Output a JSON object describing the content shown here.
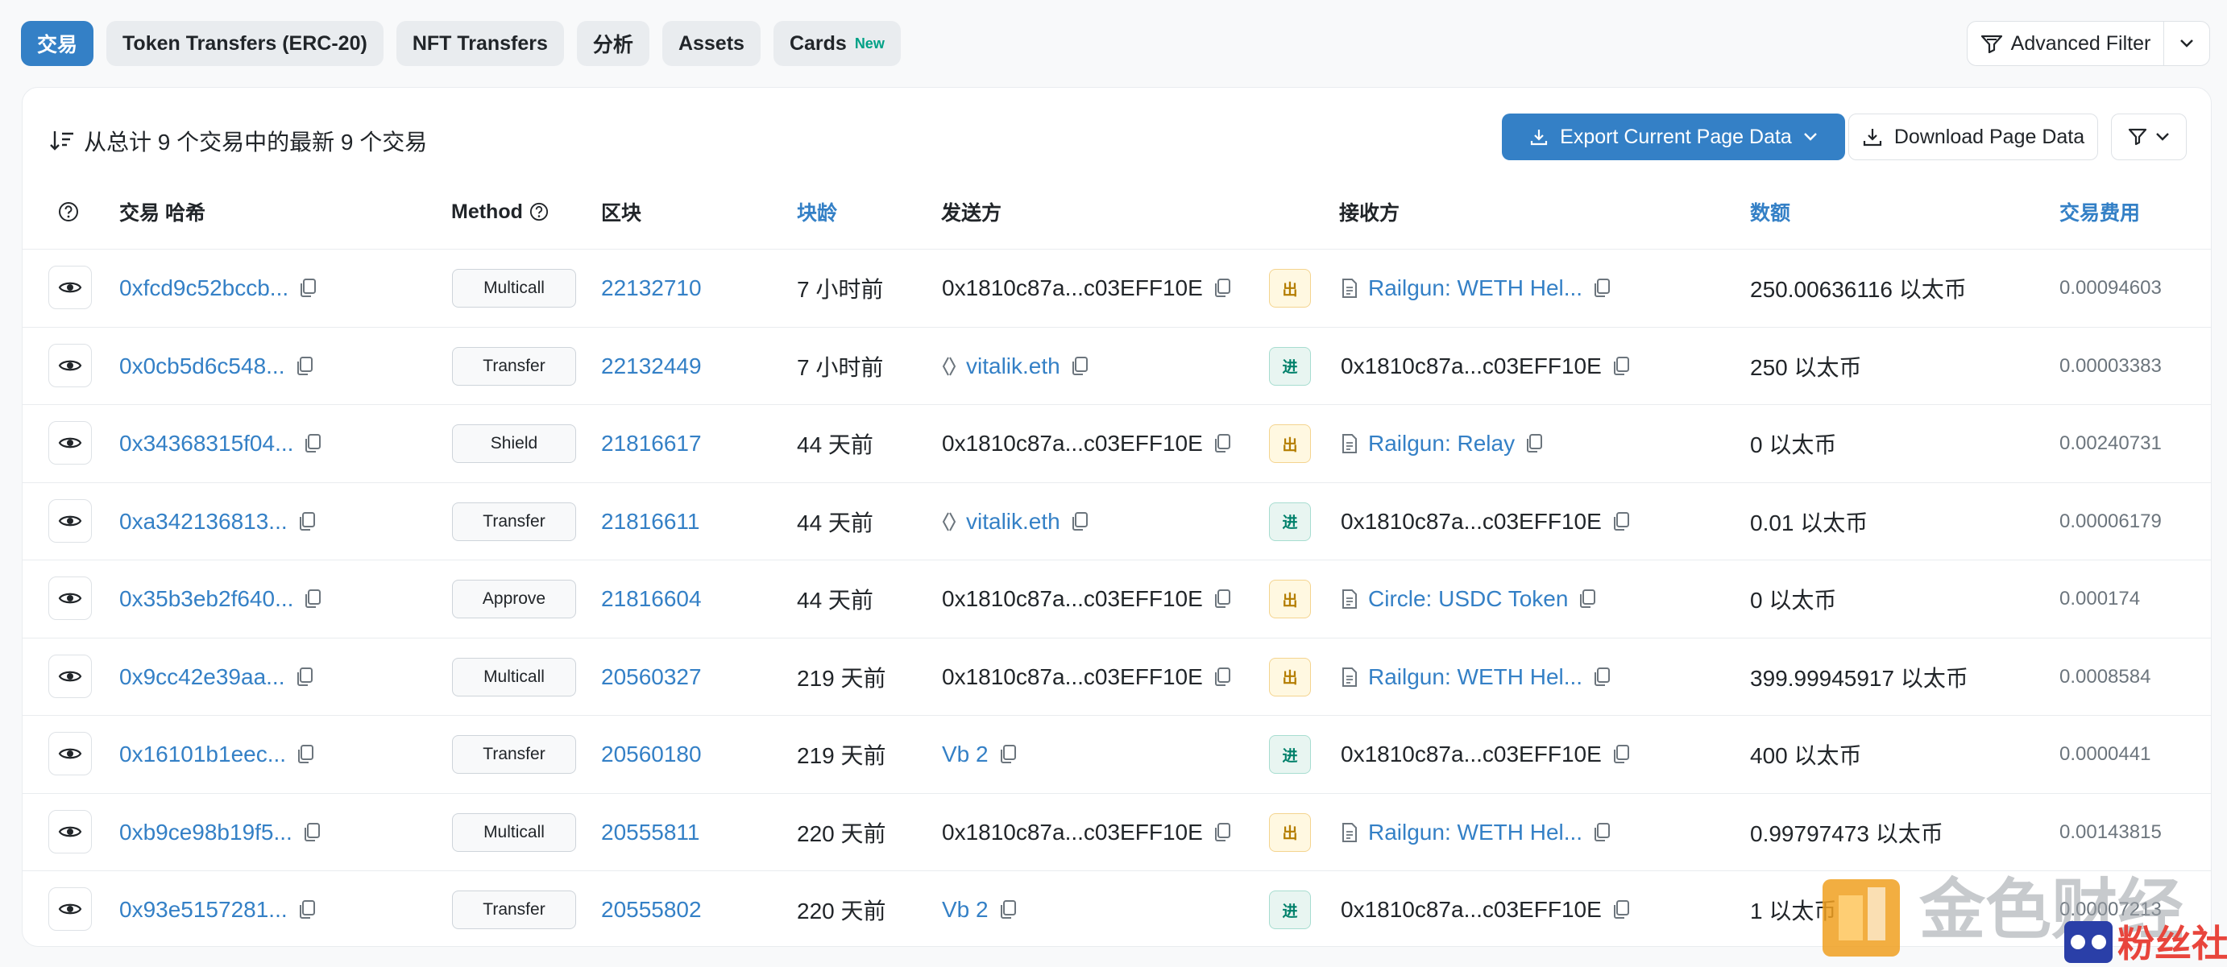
{
  "tabs": [
    {
      "label": "交易",
      "active": true
    },
    {
      "label": "Token Transfers (ERC-20)"
    },
    {
      "label": "NFT Transfers"
    },
    {
      "label": "分析"
    },
    {
      "label": "Assets"
    },
    {
      "label": "Cards",
      "badge": "New"
    }
  ],
  "advanced_filter": {
    "label": "Advanced Filter"
  },
  "summary": "从总计 9 个交易中的最新 9 个交易",
  "toolbar": {
    "export_label": "Export Current Page Data",
    "download_label": "Download Page Data"
  },
  "columns": {
    "hash": "交易 哈希",
    "method": "Method",
    "block": "区块",
    "age": "块龄",
    "from": "发送方",
    "to": "接收方",
    "amount": "数额",
    "fee": "交易费用"
  },
  "rows": [
    {
      "hash": "0xfcd9c52bccb...",
      "method": "Multicall",
      "block": "22132710",
      "age": "7 小时前",
      "from": "0x1810c87a...c03EFF10E",
      "from_type": "address",
      "dir": "出",
      "to": "Railgun: WETH Hel...",
      "to_type": "contract",
      "amount": "250.00636116 以太币",
      "fee": "0.00094603"
    },
    {
      "hash": "0x0cb5d6c548...",
      "method": "Transfer",
      "block": "22132449",
      "age": "7 小时前",
      "from": "vitalik.eth",
      "from_type": "ens",
      "dir": "进",
      "to": "0x1810c87a...c03EFF10E",
      "to_type": "address",
      "amount": "250 以太币",
      "fee": "0.00003383"
    },
    {
      "hash": "0x34368315f04...",
      "method": "Shield",
      "block": "21816617",
      "age": "44 天前",
      "from": "0x1810c87a...c03EFF10E",
      "from_type": "address",
      "dir": "出",
      "to": "Railgun: Relay",
      "to_type": "contract",
      "amount": "0 以太币",
      "fee": "0.00240731"
    },
    {
      "hash": "0xa342136813...",
      "method": "Transfer",
      "block": "21816611",
      "age": "44 天前",
      "from": "vitalik.eth",
      "from_type": "ens",
      "dir": "进",
      "to": "0x1810c87a...c03EFF10E",
      "to_type": "address",
      "amount": "0.01 以太币",
      "fee": "0.00006179"
    },
    {
      "hash": "0x35b3eb2f640...",
      "method": "Approve",
      "block": "21816604",
      "age": "44 天前",
      "from": "0x1810c87a...c03EFF10E",
      "from_type": "address",
      "dir": "出",
      "to": "Circle: USDC Token",
      "to_type": "contract",
      "amount": "0 以太币",
      "fee": "0.000174"
    },
    {
      "hash": "0x9cc42e39aa...",
      "method": "Multicall",
      "block": "20560327",
      "age": "219 天前",
      "from": "0x1810c87a...c03EFF10E",
      "from_type": "address",
      "dir": "出",
      "to": "Railgun: WETH Hel...",
      "to_type": "contract",
      "amount": "399.99945917 以太币",
      "fee": "0.0008584"
    },
    {
      "hash": "0x16101b1eec...",
      "method": "Transfer",
      "block": "20560180",
      "age": "219 天前",
      "from": "Vb 2",
      "from_type": "label",
      "dir": "进",
      "to": "0x1810c87a...c03EFF10E",
      "to_type": "address",
      "amount": "400 以太币",
      "fee": "0.0000441"
    },
    {
      "hash": "0xb9ce98b19f5...",
      "method": "Multicall",
      "block": "20555811",
      "age": "220 天前",
      "from": "0x1810c87a...c03EFF10E",
      "from_type": "address",
      "dir": "出",
      "to": "Railgun: WETH Hel...",
      "to_type": "contract",
      "amount": "0.99797473 以太币",
      "fee": "0.00143815"
    },
    {
      "hash": "0x93e5157281...",
      "method": "Transfer",
      "block": "20555802",
      "age": "220 天前",
      "from": "Vb 2",
      "from_type": "label",
      "dir": "进",
      "to": "0x1810c87a...c03EFF10E",
      "to_type": "address",
      "amount": "1 以太币",
      "fee": "0.00007213"
    }
  ],
  "watermark": {
    "text1": "金色财经",
    "text2": "粉丝社区"
  },
  "colors": {
    "accent": "#3480c6",
    "out": "#b47d00",
    "in": "#00806a"
  }
}
